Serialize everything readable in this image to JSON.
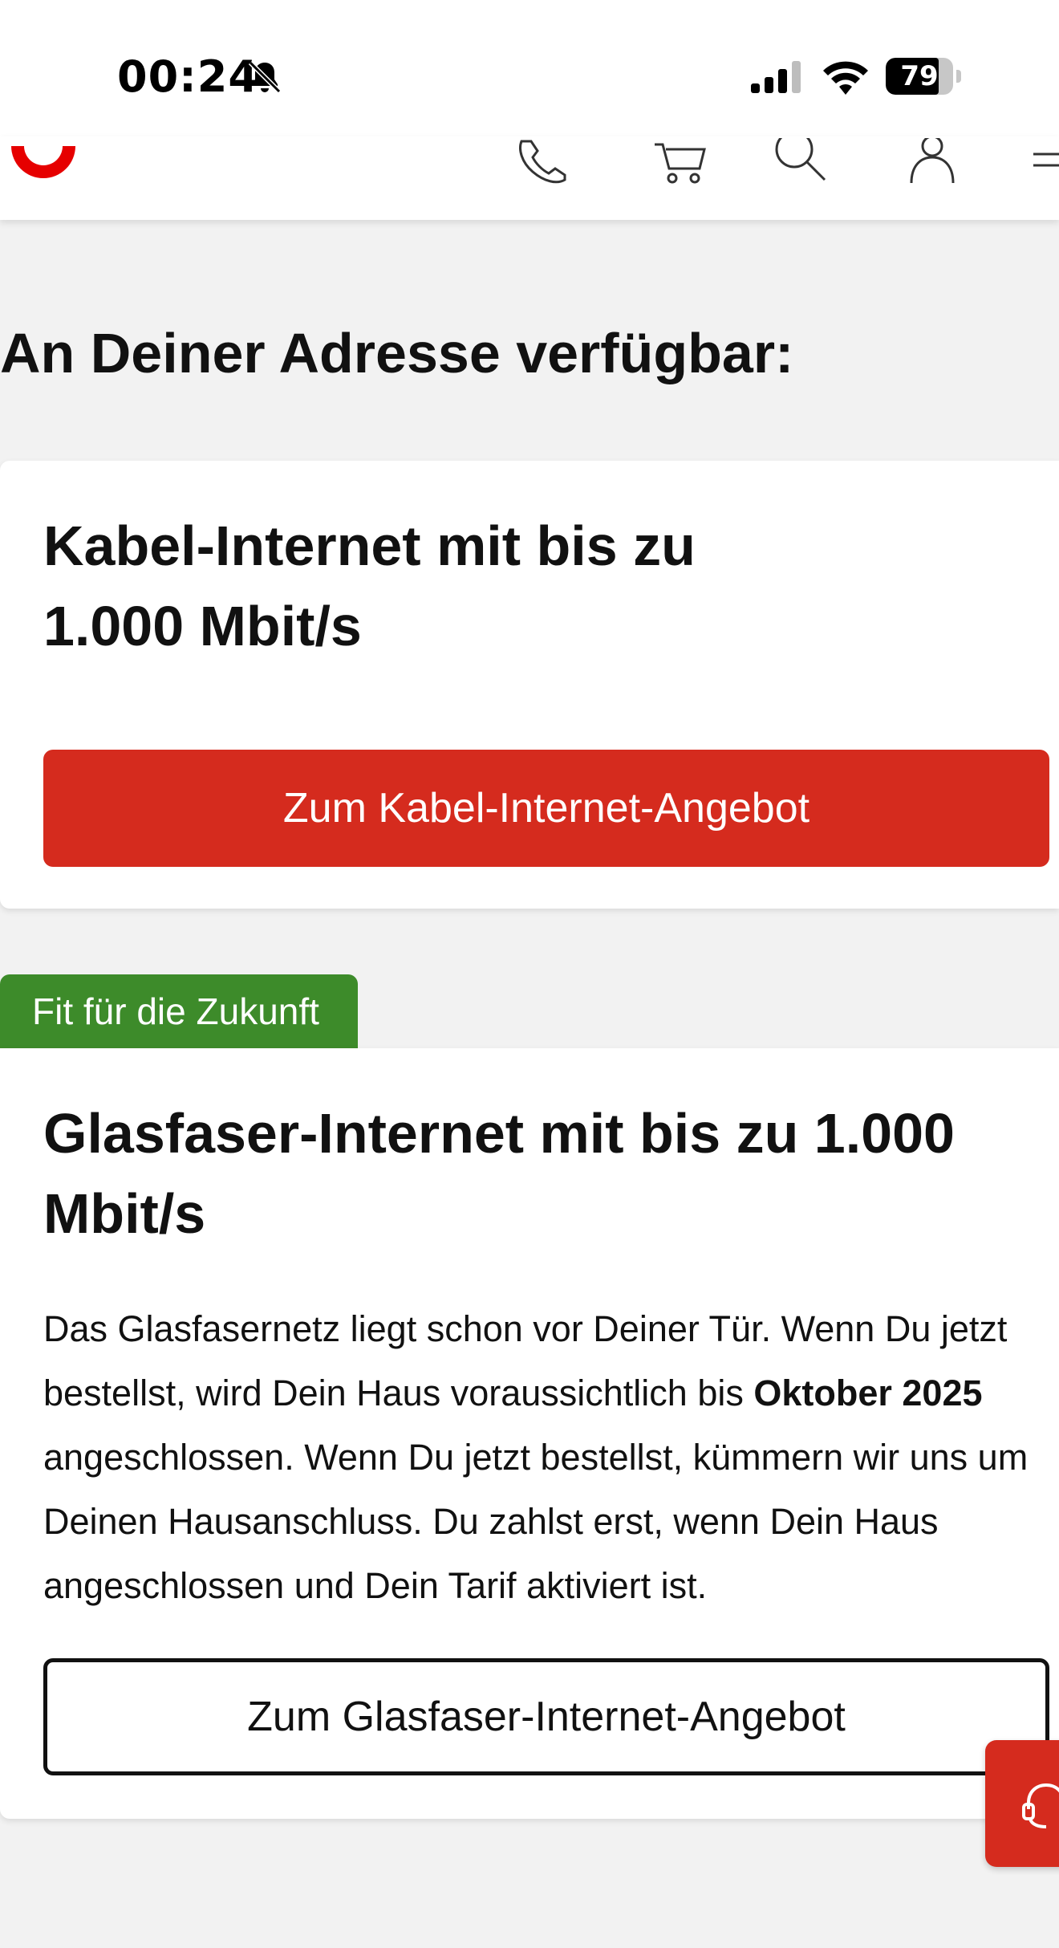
{
  "status_bar": {
    "time": "00:24",
    "battery": "79",
    "battery_level": 0.79,
    "icons": [
      "bell-off-icon",
      "signal-icon",
      "wifi-icon",
      "battery-icon"
    ]
  },
  "header": {
    "logo": "vodafone-logo",
    "nav_icons": [
      "phone-icon",
      "cart-icon",
      "search-icon",
      "account-icon",
      "menu-icon"
    ]
  },
  "main": {
    "title": "An Deiner Adresse verfügbar:",
    "cable_card": {
      "title": "Kabel-Internet mit bis zu 1.000 Mbit/s",
      "button_label": "Zum Kabel-Internet-Angebot"
    },
    "fiber_card": {
      "badge": "Fit für die Zukunft",
      "title": "Glasfaser-Internet mit bis zu 1.000 Mbit/s",
      "body_part1": "Das Glasfasernetz liegt schon vor Deiner Tür. Wenn Du jetzt bestellst, wird Dein Haus voraussichtlich bis ",
      "body_bold": "Oktober 2025",
      "body_part2": " angeschlossen. Wenn Du jetzt bestellst, kümmern wir uns um Deinen Hausanschluss. Du zahlst erst, wenn Dein Haus angeschlossen und Dein Tarif aktiviert ist.",
      "button_label": "Zum Glasfaser-Internet-Angebot"
    }
  },
  "help_button": {
    "icon": "headset-icon"
  },
  "colors": {
    "brand_red": "#d52b1e",
    "badge_green": "#3d8b2a",
    "page_background": "#f2f2f2"
  }
}
